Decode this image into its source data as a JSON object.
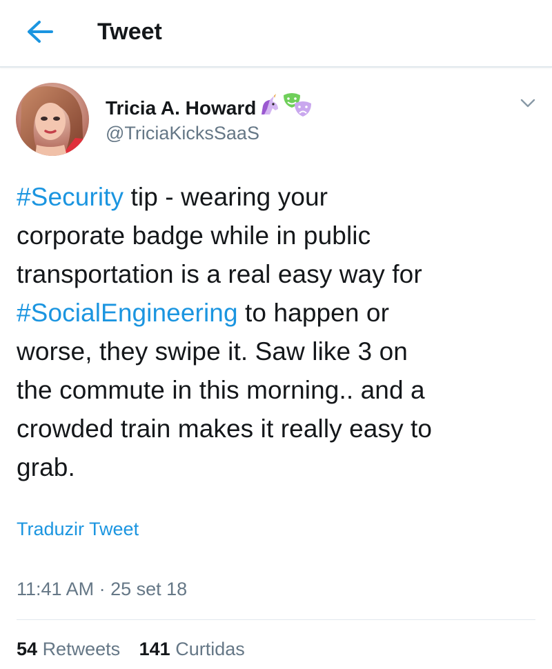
{
  "header": {
    "back_icon": "arrow-left-icon",
    "title": "Tweet"
  },
  "tweet": {
    "author": {
      "name": "Tricia A. Howard",
      "name_emojis": [
        "unicorn-emoji",
        "performing-arts-emoji"
      ],
      "handle": "@TriciaKicksSaaS",
      "avatar": "profile-photo"
    },
    "menu_icon": "chevron-down-icon",
    "text_lines": [
      [
        {
          "t": "#Security",
          "hashtag": true
        },
        {
          "t": " tip - wearing your"
        }
      ],
      [
        {
          "t": "corporate badge while in public"
        }
      ],
      [
        {
          "t": "transportation is a real easy way for"
        }
      ],
      [
        {
          "t": "#SocialEngineering",
          "hashtag": true
        },
        {
          "t": " to happen or"
        }
      ],
      [
        {
          "t": "worse, they swipe it. Saw like 3 on"
        }
      ],
      [
        {
          "t": "the commute in this morning.. and a"
        }
      ],
      [
        {
          "t": "crowded train makes it really easy to"
        }
      ],
      [
        {
          "t": "grab."
        }
      ]
    ],
    "translate_label": "Traduzir Tweet",
    "time": "11:41 AM",
    "separator": "·",
    "date": "25 set 18",
    "stats": {
      "retweets_count": "54",
      "retweets_label": "Retweets",
      "likes_count": "141",
      "likes_label": "Curtidas"
    }
  },
  "colors": {
    "link": "#1b95e0",
    "text": "#14171a",
    "secondary": "#657786",
    "divider": "#e1e8ed"
  }
}
